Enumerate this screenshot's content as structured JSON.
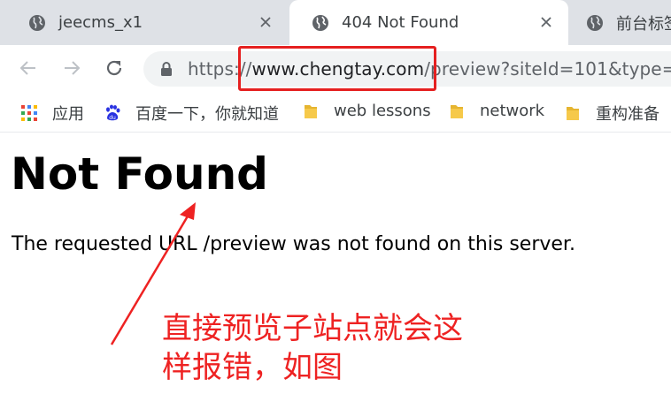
{
  "tabs": [
    {
      "label": "jeecms_x1",
      "active": false
    },
    {
      "label": "404 Not Found",
      "active": true
    },
    {
      "label": "前台标签"
    }
  ],
  "address_bar": {
    "scheme": "https://",
    "host": "www.chengtay.com",
    "path": "/preview?siteId=101&type="
  },
  "bookmarks": [
    {
      "label": "应用",
      "icon": "apps-grid-icon"
    },
    {
      "label": "百度一下，你就知道",
      "icon": "baidu-paw-icon"
    },
    {
      "label": "web lessons",
      "icon": "folder-icon"
    },
    {
      "label": "network",
      "icon": "folder-icon"
    },
    {
      "label": "重构准备",
      "icon": "folder-icon"
    }
  ],
  "page": {
    "heading": "Not Found",
    "message": "The requested URL /preview was not found on this server."
  },
  "annotation": {
    "line1": "直接预览子站点就会这",
    "line2": "样报错，如图",
    "color": "#ee2222"
  }
}
